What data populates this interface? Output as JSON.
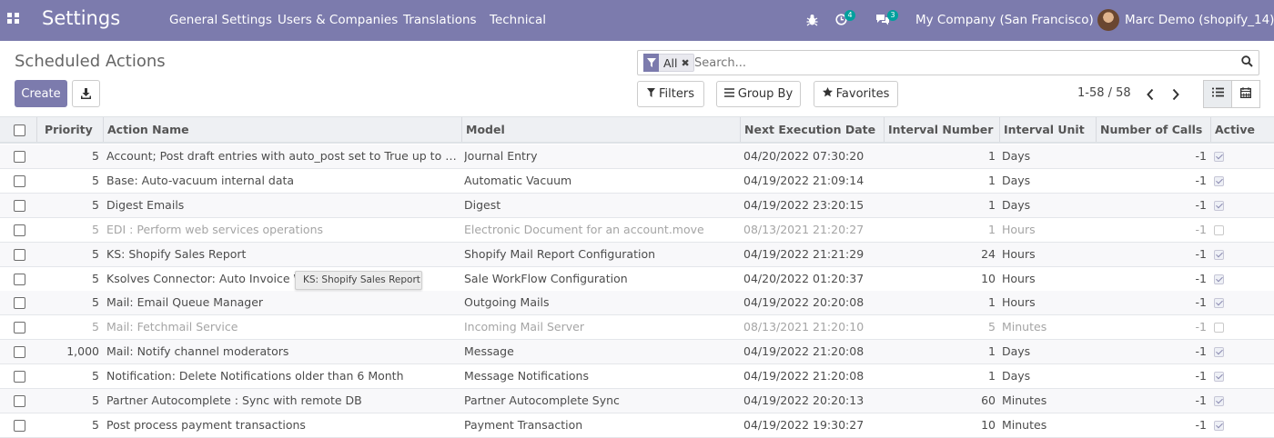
{
  "navbar": {
    "brand": "Settings",
    "menu": [
      "General Settings",
      "Users & Companies",
      "Translations",
      "Technical"
    ],
    "activity_count": "4",
    "message_count": "3",
    "company": "My Company (San Francisco)",
    "user": "Marc Demo (shopify_14)"
  },
  "page": {
    "title": "Scheduled Actions",
    "create_label": "Create"
  },
  "search": {
    "facet_label": "All",
    "placeholder": "Search..."
  },
  "panel": {
    "filters_label": "Filters",
    "group_by_label": "Group By",
    "favorites_label": "Favorites",
    "pager": "1-58 / 58"
  },
  "table": {
    "columns": [
      "Priority",
      "Action Name",
      "Model",
      "Next Execution Date",
      "Interval Number",
      "Interval Unit",
      "Number of Calls",
      "Active"
    ],
    "rows": [
      {
        "priority": "5",
        "name": "Account; Post draft entries with auto_post set to True up to today",
        "model": "Journal Entry",
        "next": "04/20/2022 07:30:20",
        "interval": "1",
        "unit": "Days",
        "calls": "-1",
        "active": true
      },
      {
        "priority": "5",
        "name": "Base: Auto-vacuum internal data",
        "model": "Automatic Vacuum",
        "next": "04/19/2022 21:09:14",
        "interval": "1",
        "unit": "Days",
        "calls": "-1",
        "active": true
      },
      {
        "priority": "5",
        "name": "Digest Emails",
        "model": "Digest",
        "next": "04/19/2022 23:20:15",
        "interval": "1",
        "unit": "Days",
        "calls": "-1",
        "active": true
      },
      {
        "priority": "5",
        "name": "EDI : Perform web services operations",
        "model": "Electronic Document for an account.move",
        "next": "08/13/2021 21:20:27",
        "interval": "1",
        "unit": "Hours",
        "calls": "-1",
        "active": false
      },
      {
        "priority": "5",
        "name": "KS: Shopify Sales Report",
        "model": "Shopify Mail Report Configuration",
        "next": "04/19/2022 21:21:29",
        "interval": "24",
        "unit": "Hours",
        "calls": "-1",
        "active": true
      },
      {
        "priority": "5",
        "name": "Ksolves Connector: Auto Invoice W",
        "model": "Sale WorkFlow Configuration",
        "next": "04/20/2022 01:20:37",
        "interval": "10",
        "unit": "Hours",
        "calls": "-1",
        "active": true
      },
      {
        "priority": "5",
        "name": "Mail: Email Queue Manager",
        "model": "Outgoing Mails",
        "next": "04/19/2022 20:20:08",
        "interval": "1",
        "unit": "Hours",
        "calls": "-1",
        "active": true
      },
      {
        "priority": "5",
        "name": "Mail: Fetchmail Service",
        "model": "Incoming Mail Server",
        "next": "08/13/2021 21:20:10",
        "interval": "5",
        "unit": "Minutes",
        "calls": "-1",
        "active": false
      },
      {
        "priority": "1,000",
        "name": "Mail: Notify channel moderators",
        "model": "Message",
        "next": "04/19/2022 21:20:08",
        "interval": "1",
        "unit": "Days",
        "calls": "-1",
        "active": true
      },
      {
        "priority": "5",
        "name": "Notification: Delete Notifications older than 6 Month",
        "model": "Message Notifications",
        "next": "04/19/2022 21:20:08",
        "interval": "1",
        "unit": "Days",
        "calls": "-1",
        "active": true
      },
      {
        "priority": "5",
        "name": "Partner Autocomplete : Sync with remote DB",
        "model": "Partner Autocomplete Sync",
        "next": "04/19/2022 20:20:13",
        "interval": "60",
        "unit": "Minutes",
        "calls": "-1",
        "active": true
      },
      {
        "priority": "5",
        "name": "Post process payment transactions",
        "model": "Payment Transaction",
        "next": "04/19/2022 19:30:27",
        "interval": "10",
        "unit": "Minutes",
        "calls": "-1",
        "active": true
      }
    ]
  },
  "tooltip": "KS: Shopify Sales Report",
  "colors": {
    "brand": "#7c7bad",
    "badge": "#00a09d"
  },
  "icons": {
    "apps": "apps-grid-icon",
    "debug": "bug-icon",
    "activity": "clock-icon",
    "messages": "chat-icon",
    "download": "download-icon",
    "filter": "filter-icon",
    "search": "search-icon",
    "list_view": "list-view-icon",
    "calendar_view": "calendar-view-icon"
  }
}
